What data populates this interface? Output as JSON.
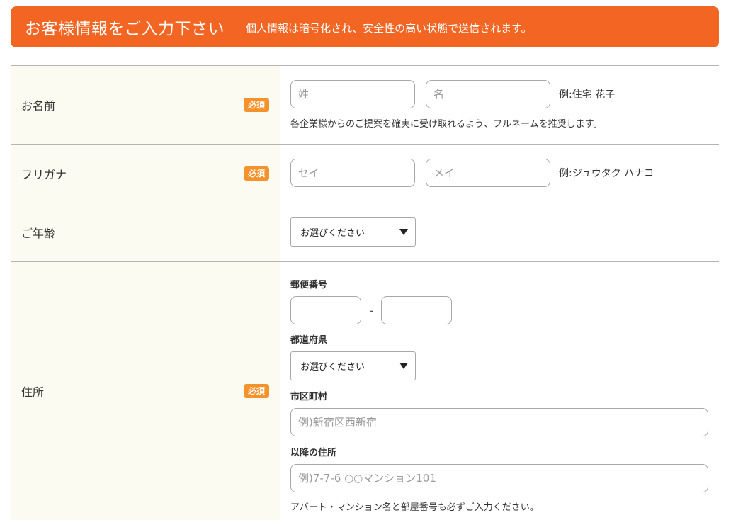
{
  "header": {
    "title": "お客様情報をご入力下さい",
    "subtitle": "個人情報は暗号化され、安全性の高い状態で送信されます。"
  },
  "required_badge": "必須",
  "name": {
    "label": "お名前",
    "last_placeholder": "姓",
    "first_placeholder": "名",
    "example": "例:住宅 花子",
    "hint": "各企業様からのご提案を確実に受け取れるよう、フルネームを推奨します。"
  },
  "kana": {
    "label": "フリガナ",
    "last_placeholder": "セイ",
    "first_placeholder": "メイ",
    "example": "例:ジュウタク ハナコ"
  },
  "age": {
    "label": "ご年齢",
    "selected": "お選びください"
  },
  "address": {
    "label": "住所",
    "postal_label": "郵便番号",
    "postal_separator": "-",
    "prefecture_label": "都道府県",
    "prefecture_selected": "お選びください",
    "city_label": "市区町村",
    "city_placeholder": "例)新宿区西新宿",
    "street_label": "以降の住所",
    "street_placeholder": "例)7-7-6 ○○マンション101",
    "hint": "アパート・マンション名と部屋番号も必ずご入力ください。"
  },
  "colors": {
    "accent": "#f26522",
    "badge": "#f6922c",
    "label_bg": "#fcfbf1"
  }
}
